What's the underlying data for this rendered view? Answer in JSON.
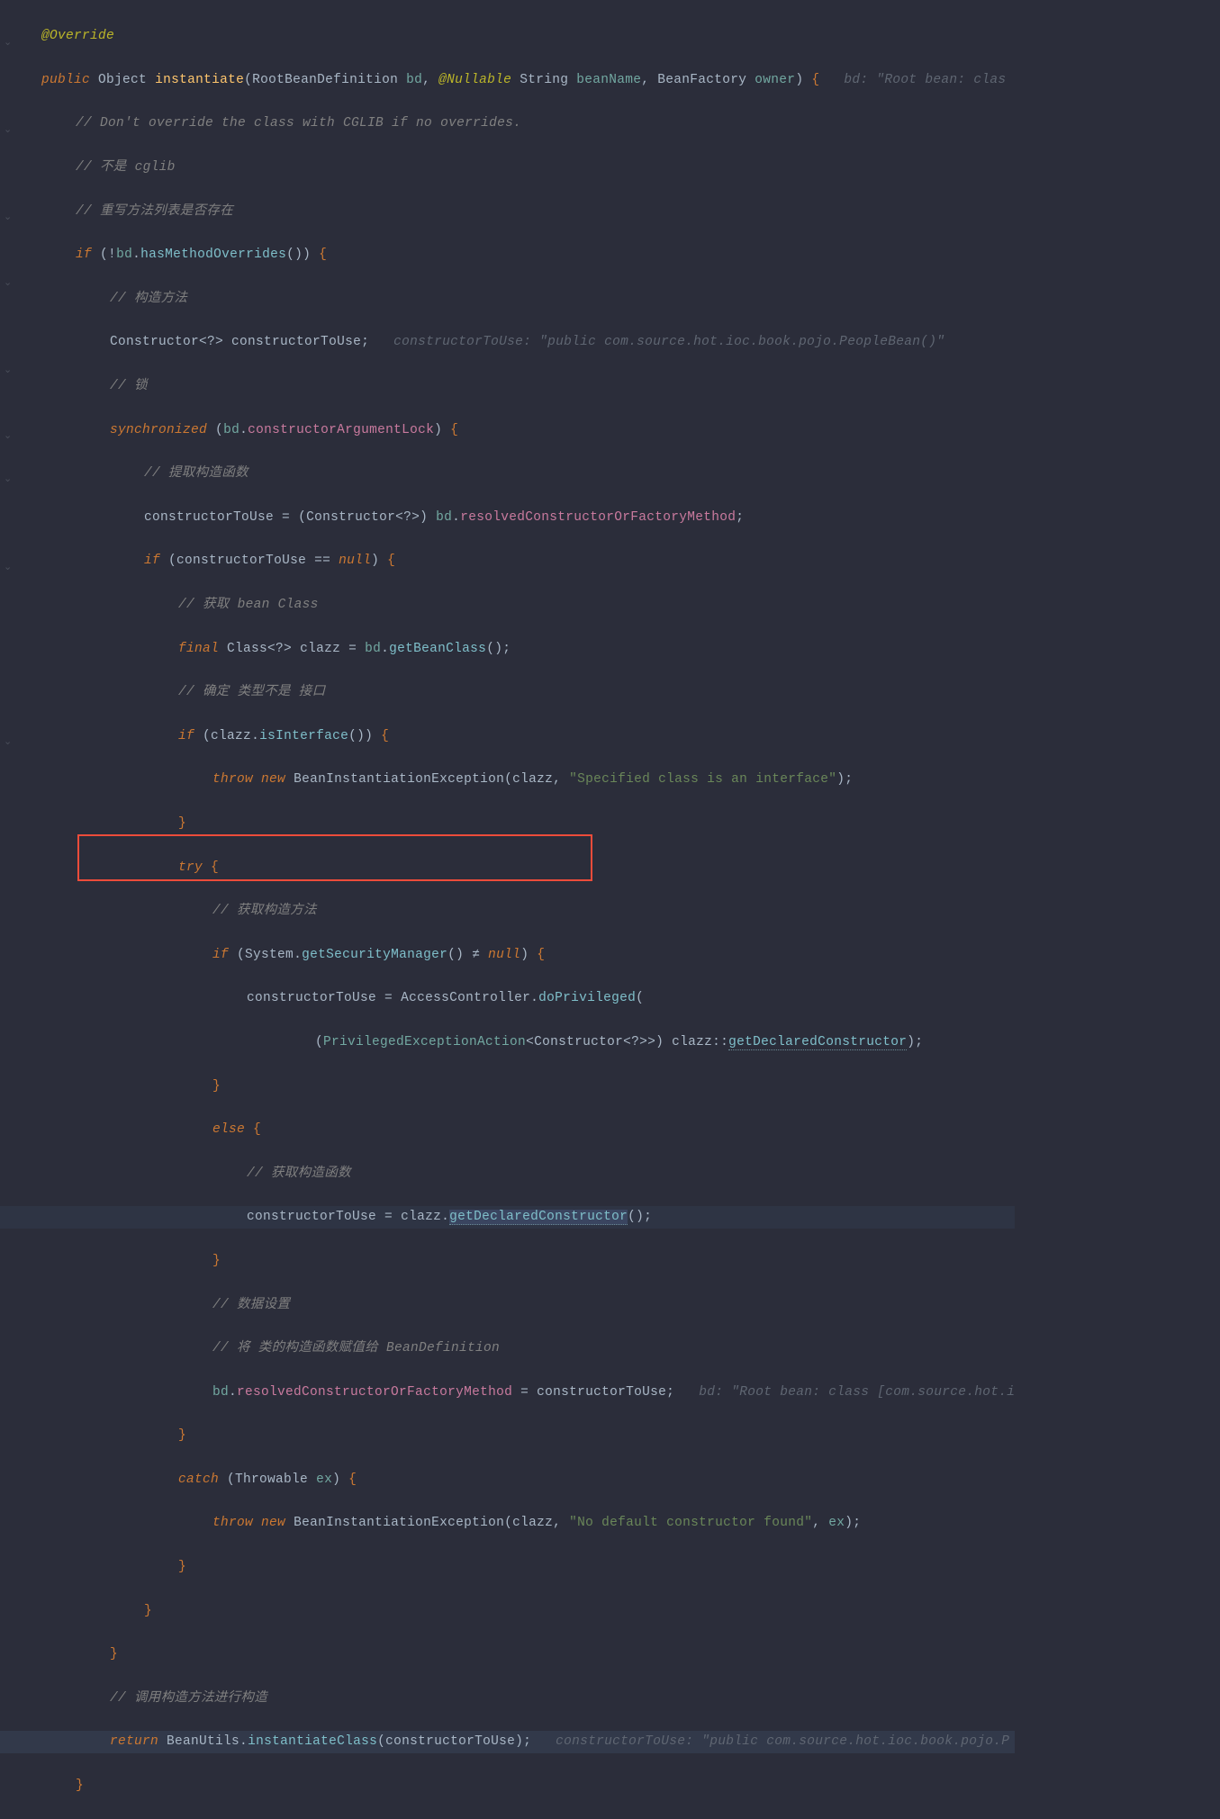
{
  "annotations": {
    "override": "@Override",
    "nullable": "@Nullable"
  },
  "keywords": {
    "public": "public",
    "if": "if",
    "final": "final",
    "throw": "throw",
    "new": "new",
    "try": "try",
    "else": "else",
    "catch": "catch",
    "return": "return",
    "synchronized": "synchronized",
    "null": "null"
  },
  "types": {
    "Object": "Object",
    "RootBeanDefinition": "RootBeanDefinition",
    "String": "String",
    "BeanFactory": "BeanFactory",
    "Constructor": "Constructor",
    "Class": "Class",
    "BeanInstantiationException": "BeanInstantiationException",
    "System": "System",
    "AccessController": "AccessController",
    "PrivilegedExceptionAction": "PrivilegedExceptionAction",
    "Throwable": "Throwable",
    "BeanUtils": "BeanUtils"
  },
  "methods": {
    "instantiate": "instantiate",
    "hasMethodOverrides": "hasMethodOverrides",
    "isInterface": "isInterface",
    "getSecurityManager": "getSecurityManager",
    "doPrivileged": "doPrivileged",
    "getDeclaredConstructor": "getDeclaredConstructor",
    "getBeanClass": "getBeanClass",
    "instantiateClass": "instantiateClass"
  },
  "fields": {
    "constructorArgumentLock": "constructorArgumentLock",
    "resolvedConstructorOrFactoryMethod": "resolvedConstructorOrFactoryMethod"
  },
  "vars": {
    "bd": "bd",
    "beanName": "beanName",
    "owner": "owner",
    "constructorToUse": "constructorToUse",
    "clazz": "clazz",
    "ex": "ex"
  },
  "strings": {
    "interface": "\"Specified class is an interface\"",
    "noDefault": "\"No default constructor found\""
  },
  "comments": {
    "c1": "// Don't override the class with CGLIB if no overrides.",
    "c2": "// 不是 cglib",
    "c3": "// 重写方法列表是否存在",
    "c4": "// 构造方法",
    "c5": "// 锁",
    "c6": "// 提取构造函数",
    "c7": "// 获取 bean Class",
    "c8": "// 确定 类型不是 接口",
    "c9": "// 获取构造方法",
    "c10": "// 获取构造函数",
    "c11": "// 数据设置",
    "c12": "// 将 类的构造函数赋值给 BeanDefinition",
    "c13": "// 调用构造方法进行构造"
  },
  "hints": {
    "h1": "bd: \"Root bean: clas",
    "h2": "constructorToUse: \"public com.source.hot.ioc.book.pojo.PeopleBean()\"",
    "h3": "bd: \"Root bean: class [com.source.hot.i",
    "h4": "constructorToUse: \"public com.source.hot.ioc.book.pojo.P"
  },
  "ops": {
    "neq": "≠",
    "eq": "==",
    "assign": "=",
    "bang": "!",
    "dcolon": "::"
  }
}
